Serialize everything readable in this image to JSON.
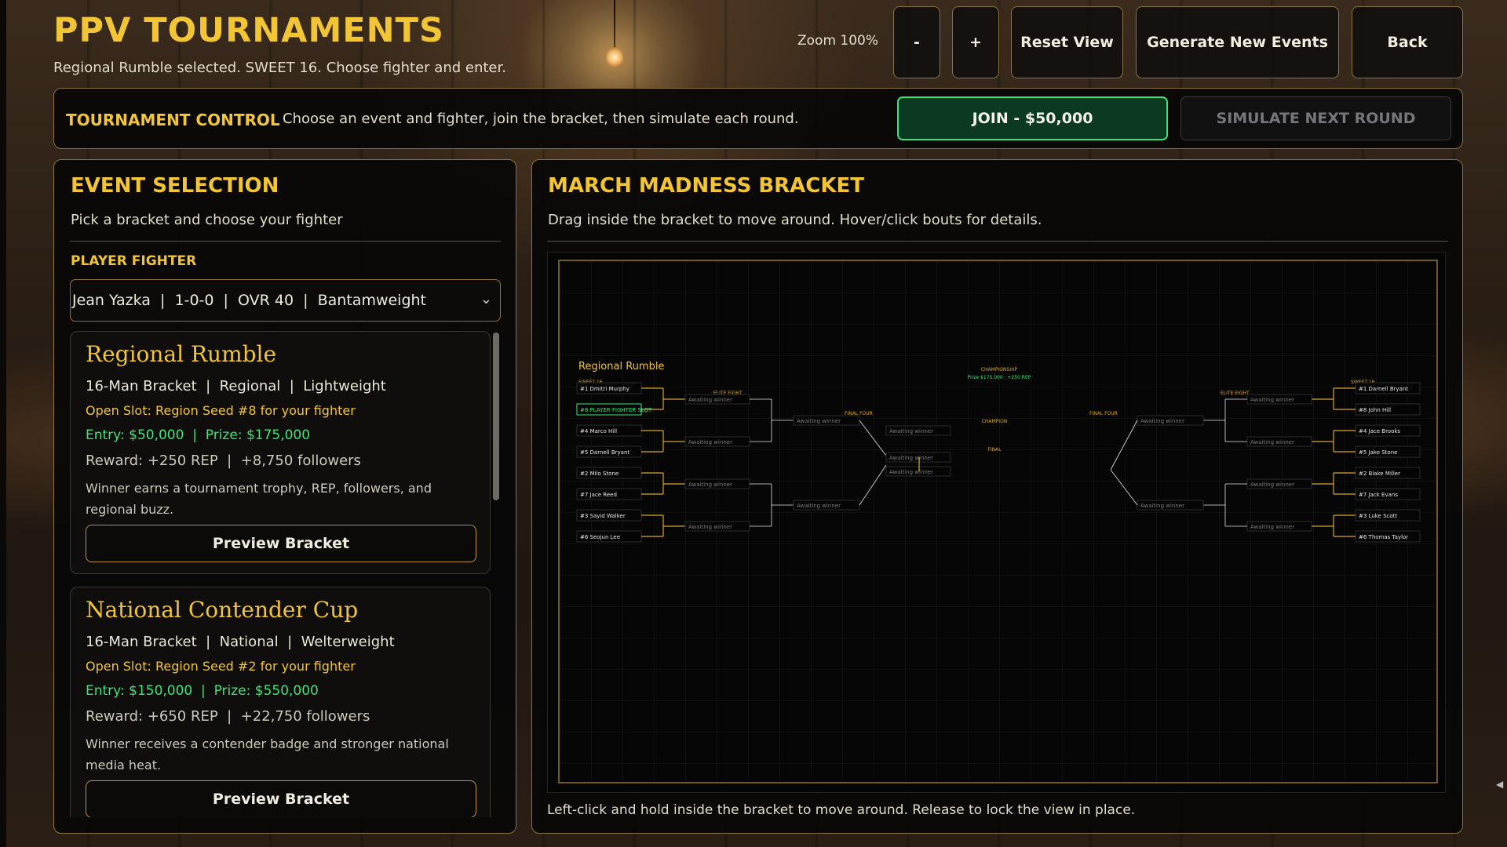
{
  "header": {
    "title": "PPV TOURNAMENTS",
    "subtitle": "Regional Rumble selected. SWEET 16. Choose fighter and enter.",
    "zoom_label": "Zoom 100%",
    "buttons": {
      "zoom_out": "-",
      "zoom_in": "+",
      "reset_view": "Reset View",
      "generate": "Generate New Events",
      "back": "Back"
    }
  },
  "control": {
    "title": "TOURNAMENT CONTROL",
    "description": "Choose an event and fighter, join the bracket, then simulate each round.",
    "join_label": "JOIN - $50,000",
    "simulate_label": "SIMULATE NEXT ROUND"
  },
  "event_selection": {
    "title": "EVENT SELECTION",
    "subtitle": "Pick a bracket and choose your fighter",
    "fighter_label": "PLAYER FIGHTER",
    "fighter_selected": "Jean Yazka  |  1-0-0  |  OVR 40  |  Bantamweight",
    "events": [
      {
        "name": "Regional Rumble",
        "meta": "16-Man Bracket  |  Regional  |  Lightweight",
        "slot": "Open Slot: Region Seed #8 for your fighter",
        "money": "Entry: $50,000  |  Prize: $175,000",
        "reward": "Reward: +250 REP  |  +8,750 followers",
        "desc": "Winner earns a tournament trophy, REP, followers, and regional buzz.",
        "button": "Preview Bracket"
      },
      {
        "name": "National Contender Cup",
        "meta": "16-Man Bracket  |  National  |  Welterweight",
        "slot": "Open Slot: Region Seed #2 for your fighter",
        "money": "Entry: $150,000  |  Prize: $550,000",
        "reward": "Reward: +650 REP  |  +22,750 followers",
        "desc": "Winner receives a contender badge and stronger national media heat.",
        "button": "Preview Bracket"
      }
    ]
  },
  "bracket": {
    "title": "MARCH MADNESS BRACKET",
    "subtitle": "Drag inside the bracket to move around. Hover/click bouts for details.",
    "footer": "Left-click and hold inside the bracket to move around. Release to lock the view in place.",
    "event_name": "Regional Rumble",
    "labels": {
      "sweet16": "SWEET 16",
      "elite8": "ELITE EIGHT",
      "final4": "FINAL FOUR",
      "championship": "CHAMPIONSHIP",
      "champ_prize": "Prize $175,000  ·  +250 REP",
      "champion": "CHAMPION",
      "final": "FINAL",
      "awaiting": "Awaiting winner"
    },
    "left_entrants": [
      "#1 Dmitri Murphy",
      "#8 PLAYER FIGHTER SLOT",
      "#4 Marco Hill",
      "#5 Darnell Bryant",
      "#2 Milo Stone",
      "#7 Jace Reed",
      "#3 Sayid Walker",
      "#6 Seojun Lee"
    ],
    "right_entrants": [
      "#1 Darnell Bryant",
      "#8 John Hill",
      "#4 Jace Brooks",
      "#5 Jake Stone",
      "#2 Blake Miller",
      "#7 Jack Evans",
      "#3 Luke Scott",
      "#6 Thomas Taylor"
    ],
    "player_index_left": 1
  }
}
